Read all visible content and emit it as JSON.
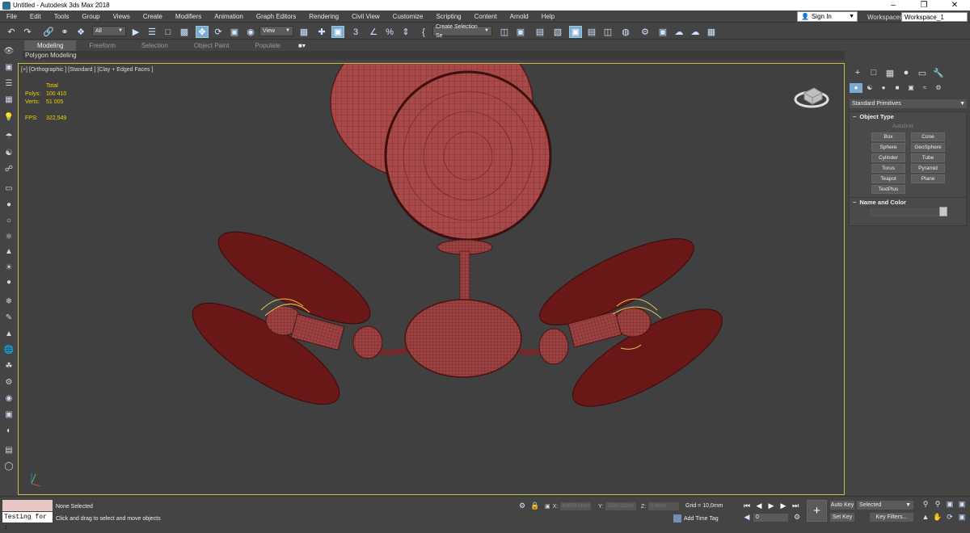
{
  "window": {
    "title": "Untitled - Autodesk 3ds Max 2018"
  },
  "menu": [
    "File",
    "Edit",
    "Tools",
    "Group",
    "Views",
    "Create",
    "Modifiers",
    "Animation",
    "Graph Editors",
    "Rendering",
    "Civil View",
    "Customize",
    "Scripting",
    "Content",
    "Arnold",
    "Help"
  ],
  "account": {
    "sign_in": "Sign In",
    "workspaces_label": "Workspaces:",
    "workspace": "Workspace_1"
  },
  "toolbar": {
    "filter": "All",
    "ref_coord": "View",
    "selection_set": "Create Selection Se"
  },
  "ribbon": {
    "tabs": [
      "Modeling",
      "Freeform",
      "Selection",
      "Object Paint",
      "Populate"
    ],
    "active_tab": "Modeling",
    "panel": "Polygon Modeling"
  },
  "viewport": {
    "label": "[+] [Orthographic ] [Standard ] [Clay + Edged Faces ]",
    "stats": {
      "total_label": "Total",
      "polys_label": "Polys:",
      "polys": "100 410",
      "verts_label": "Verts:",
      "verts": "51 005",
      "fps_label": "FPS:",
      "fps": "322,549"
    }
  },
  "command_panel": {
    "category": "Standard Primitives",
    "object_type": {
      "title": "Object Type",
      "autogrid": "AutoGrid",
      "buttons": [
        "Box",
        "Cone",
        "Sphere",
        "GeoSphere",
        "Cylinder",
        "Tube",
        "Torus",
        "Pyramid",
        "Teapot",
        "Plane",
        "TextPlus"
      ]
    },
    "name_color": {
      "title": "Name and Color"
    }
  },
  "status": {
    "listener": "Testing for :",
    "selection": "None Selected",
    "prompt": "Click and drag to select and move objects",
    "x_label": "X:",
    "x": "49650,0mm",
    "y_label": "Y:",
    "y": "1530,182m",
    "z_label": "Z:",
    "z": "0,0mm",
    "grid": "Grid = 10,0mm",
    "add_time_tag": "Add Time Tag",
    "frame": "0",
    "auto_key": "Auto Key",
    "set_key": "Set Key",
    "selected": "Selected",
    "key_filters": "Key Filters..."
  },
  "colors": {
    "mesh": "#a84a4a",
    "mesh_dark": "#6a1f1f",
    "viewport_bg": "#404040",
    "viewport_border": "#c8b94a",
    "stats_text": "#f2d100",
    "active_blue": "#7da9d6"
  }
}
